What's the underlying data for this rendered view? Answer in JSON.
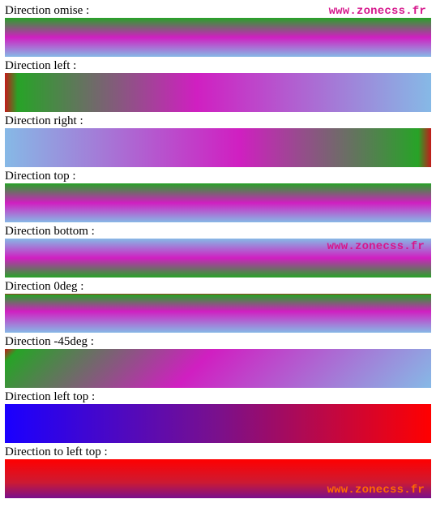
{
  "watermark": "www.zonecss.fr",
  "rows": {
    "omise": {
      "label": "Direction omise :"
    },
    "left": {
      "label": "Direction left :"
    },
    "right": {
      "label": "Direction right :"
    },
    "top": {
      "label": "Direction top :"
    },
    "bottom": {
      "label": "Direction bottom :"
    },
    "deg0": {
      "label": "Direction 0deg :"
    },
    "degm45": {
      "label": "Direction -45deg :"
    },
    "lefttop": {
      "label": "Direction left top :"
    },
    "tolefttop": {
      "label": "Direction to left top :"
    }
  }
}
